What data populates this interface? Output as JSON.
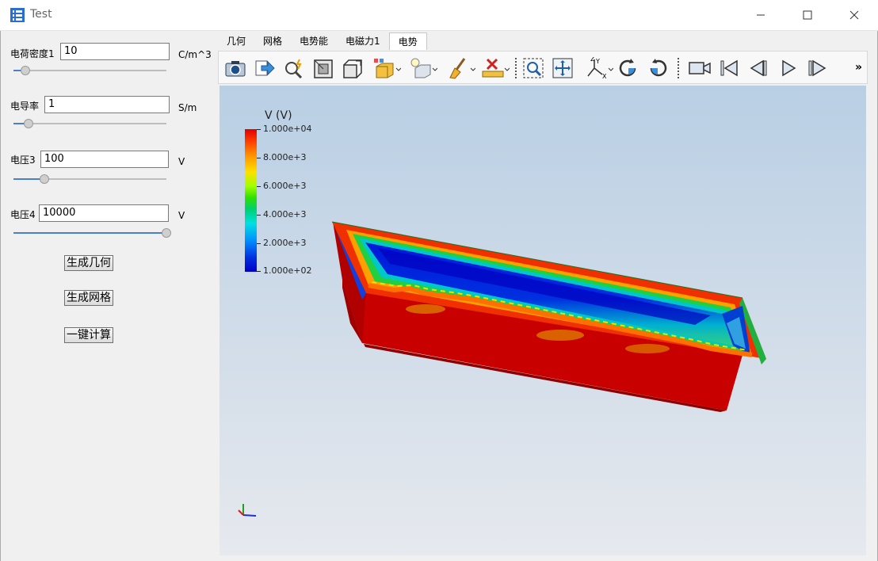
{
  "window": {
    "title": "Test"
  },
  "params": [
    {
      "label": "电荷密度1",
      "value": "10",
      "unit": "C/m^3",
      "level": 0.08
    },
    {
      "label": "电导率",
      "value": "1",
      "unit": "S/m",
      "level": 0.1
    },
    {
      "label": "电压3",
      "value": "100",
      "unit": "V",
      "level": 0.2
    },
    {
      "label": "电压4",
      "value": "10000",
      "unit": "V",
      "level": 1.0
    }
  ],
  "buttons": {
    "gen_geometry": "生成几何",
    "gen_mesh": "生成网格",
    "one_click_calc": "一键计算"
  },
  "tabs": [
    {
      "label": "几何",
      "active": false
    },
    {
      "label": "网格",
      "active": false
    },
    {
      "label": "电势能",
      "active": false
    },
    {
      "label": "电磁力1",
      "active": false
    },
    {
      "label": "电势",
      "active": true
    }
  ],
  "toolbar": {
    "icons": [
      "camera-icon",
      "export-icon",
      "magic-zoom-icon",
      "view-front-icon",
      "view-iso-icon",
      "render-mode-icon",
      "light-icon",
      "clear-brush-icon",
      "measure-icon",
      "zoom-box-icon",
      "fit-view-icon",
      "axes-icon",
      "rotate-cw-icon",
      "rotate-ccw-icon",
      "record-icon",
      "first-frame-icon",
      "prev-frame-icon",
      "play-icon",
      "next-frame-icon"
    ],
    "more": "»"
  },
  "colorbar": {
    "title": "V (V)",
    "labels": [
      "1.000e+04",
      "8.000e+3",
      "6.000e+3",
      "4.000e+3",
      "2.000e+3",
      "1.000e+02"
    ],
    "colors": {
      "max": "#e00000",
      "mid": "#30e000",
      "min": "#0000c8"
    }
  }
}
